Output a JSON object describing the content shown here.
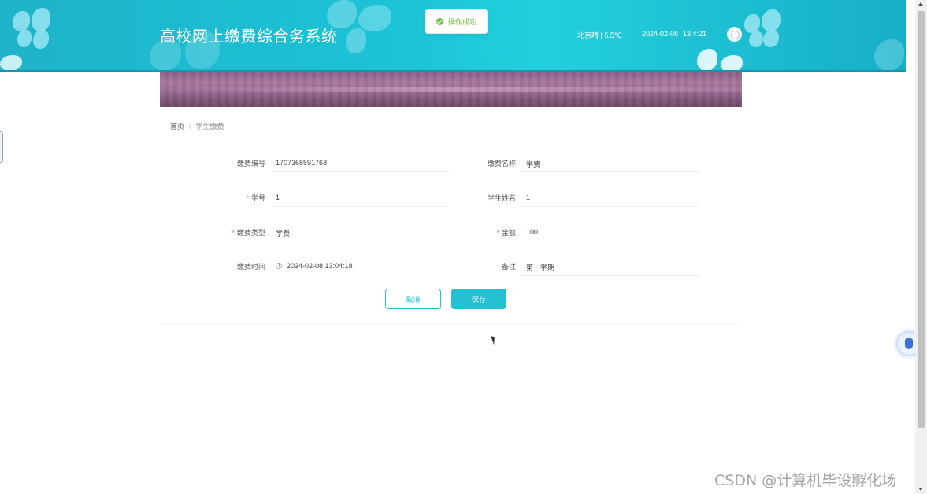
{
  "header": {
    "title": "高校网上缴费综合务系统",
    "weather": "北京晴 | 5.5℃",
    "date": "2024-02-08",
    "time": "13:4:21"
  },
  "toast": {
    "message": "操作成功",
    "icon": "check-circle-icon",
    "color": "#67c23a"
  },
  "breadcrumb": {
    "home": "首页",
    "separator": "/",
    "current": "学生缴费"
  },
  "form": {
    "fields": {
      "payment_no": {
        "label": "缴费编号",
        "value": "1707368591768",
        "required": false
      },
      "payment_name": {
        "label": "缴费名称",
        "value": "学费",
        "required": false
      },
      "student_no": {
        "label": "学号",
        "value": "1",
        "required": true
      },
      "student_name": {
        "label": "学生姓名",
        "value": "1",
        "required": false
      },
      "payment_type": {
        "label": "缴费类型",
        "value": "学费",
        "required": true
      },
      "amount": {
        "label": "金额",
        "value": "100",
        "required": true
      },
      "payment_time": {
        "label": "缴费时间",
        "value": "2024-02-08 13:04:18",
        "required": false
      },
      "remark": {
        "label": "备注",
        "value": "第一学期",
        "required": false
      }
    },
    "required_mark": "*",
    "cancel_label": "取消",
    "save_label": "保存"
  },
  "watermark": "CSDN @计算机毕设孵化场",
  "colors": {
    "accent": "#26c0d3",
    "header": "#1cc4d6",
    "success": "#67c23a",
    "required": "#f56c6c"
  }
}
